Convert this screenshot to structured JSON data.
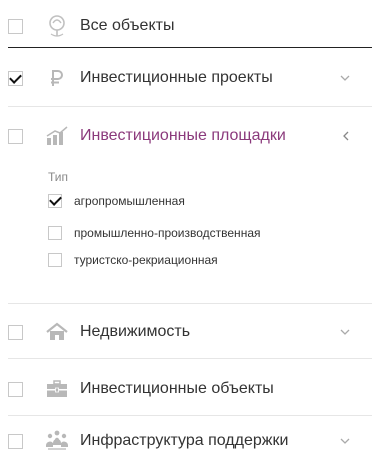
{
  "colors": {
    "active_text": "#8b3a7c",
    "icon_gray": "#b8b8b8",
    "divider": "#e6e6e6"
  },
  "items": [
    {
      "label": "Все объекты",
      "checked": false,
      "icon": "map-pin-icon",
      "chevron": "none"
    },
    {
      "label": "Инвестиционные проекты",
      "checked": true,
      "icon": "ruble-icon",
      "chevron": "chevron-down-icon"
    },
    {
      "label": "Инвестиционные площадки",
      "checked": false,
      "icon": "bar-chart-icon",
      "chevron": "chevron-left-icon",
      "expanded": true
    },
    {
      "label": "Недвижимость",
      "checked": false,
      "icon": "home-icon",
      "chevron": "chevron-down-icon"
    },
    {
      "label": "Инвестиционные объекты",
      "checked": false,
      "icon": "briefcase-icon",
      "chevron": "none"
    },
    {
      "label": "Инфраструктура поддержки",
      "checked": false,
      "icon": "people-group-icon",
      "chevron": "chevron-down-icon"
    }
  ],
  "subfilter": {
    "title": "Тип",
    "options": [
      {
        "label": "агропромышленная",
        "checked": true
      },
      {
        "label": "промышленно-производственная",
        "checked": false
      },
      {
        "label": "туристско-рекриационная",
        "checked": false
      }
    ]
  }
}
